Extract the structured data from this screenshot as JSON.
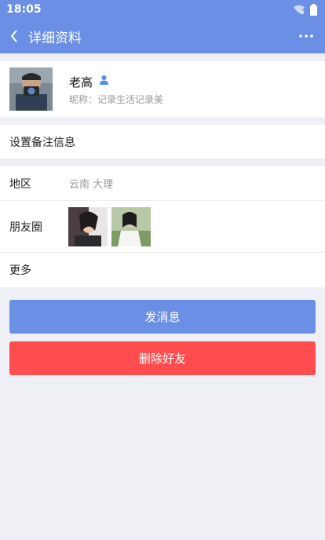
{
  "status": {
    "time": "18:05"
  },
  "nav": {
    "title": "详细资料"
  },
  "profile": {
    "name": "老高",
    "nickname_label": "昵称：",
    "nickname": "记录生活记录美"
  },
  "remark": {
    "label": "设置备注信息"
  },
  "region": {
    "label": "地区",
    "value": "云南 大理"
  },
  "moments": {
    "label": "朋友圈"
  },
  "more": {
    "label": "更多"
  },
  "actions": {
    "send_message": "发消息",
    "delete_friend": "删除好友"
  },
  "colors": {
    "primary": "#6a8fe4",
    "danger": "#ff4d4f",
    "background": "#eef0f5"
  }
}
